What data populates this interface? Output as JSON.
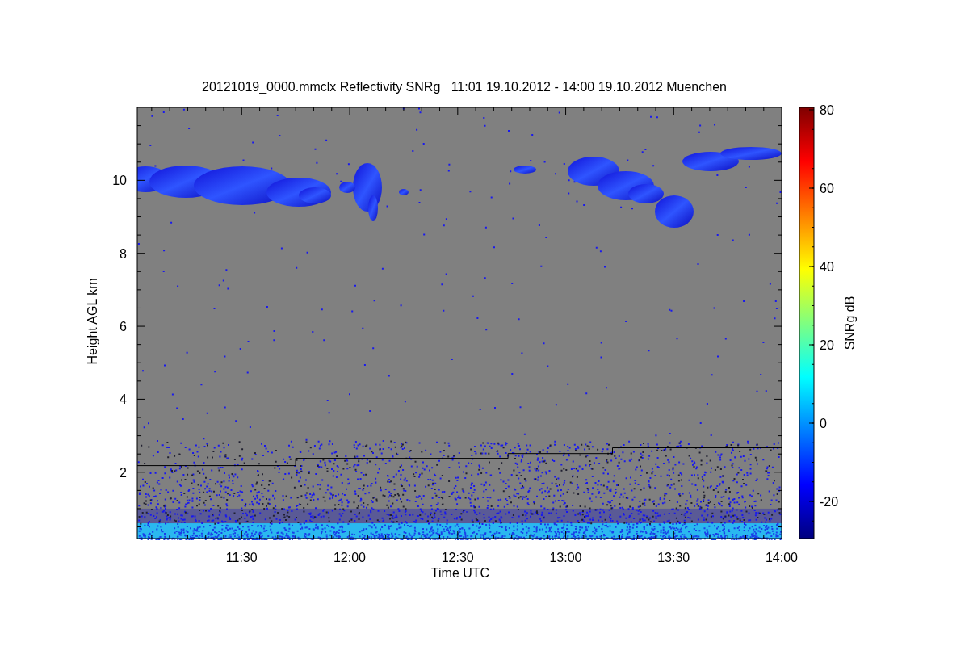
{
  "chart": {
    "chart_data": {
      "type": "line",
      "title": "20121019_0000.mmclx Reflectivity SNRg   11:01 19.10.2012 - 14:00 19.10.2012 Muenchen",
      "xlabel": "Time UTC",
      "ylabel": "Height AGL km",
      "x": [
        11.017,
        11.75,
        11.75,
        12.733,
        12.733,
        13.217,
        13.217,
        14.0
      ],
      "series": [
        {
          "color": "#000000",
          "values": [
            2.18,
            2.18,
            2.38,
            2.38,
            2.51,
            2.51,
            2.67,
            2.67
          ]
        }
      ],
      "xlim": [
        11.017,
        14.0
      ],
      "ylim": [
        0.18,
        12
      ],
      "xticks": [
        {
          "value": 11.5,
          "label": "11:30"
        },
        {
          "value": 12,
          "label": "12:00"
        },
        {
          "value": 12.5,
          "label": "12:30"
        },
        {
          "value": 13,
          "label": "13:00"
        },
        {
          "value": 13.5,
          "label": "13:30"
        },
        {
          "value": 14,
          "label": "14:00"
        }
      ],
      "yticks": [
        2,
        4,
        6,
        8,
        10
      ]
    }
  },
  "colorbar": {
    "label": "SNRg dB",
    "ticks": [
      "80",
      "60",
      "40",
      "20",
      "0",
      "-20"
    ]
  }
}
